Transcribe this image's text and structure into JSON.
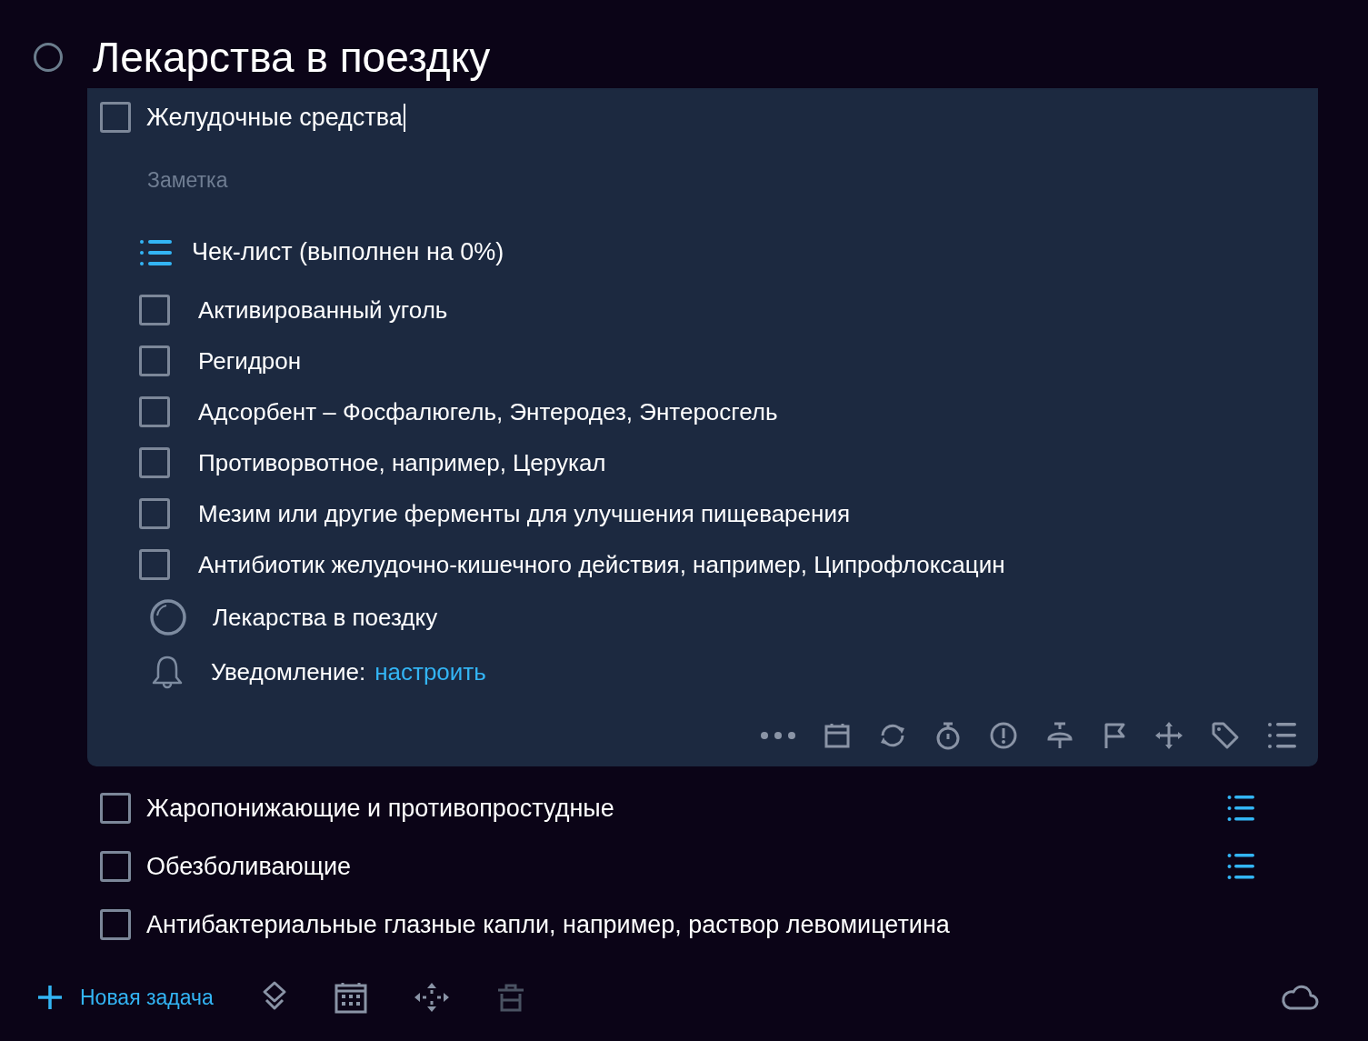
{
  "title": "Лекарства в поездку",
  "project_done": false,
  "expanded_task": {
    "title": "Желудочные средства",
    "checked": false,
    "note_placeholder": "Заметка",
    "checklist_title": "Чек-лист (выполнен на 0%)",
    "checklist": [
      {
        "text": "Активированный уголь",
        "checked": false
      },
      {
        "text": "Регидрон",
        "checked": false
      },
      {
        "text": "Адсорбент – Фосфалюгель, Энтеродез, Энтеросгель",
        "checked": false
      },
      {
        "text": "Противорвотное, например, Церукал",
        "checked": false
      },
      {
        "text": "Мезим или другие ферменты для улучшения пищеварения",
        "checked": false
      },
      {
        "text": "Антибиотик желудочно-кишечного действия, например, Ципрофлоксацин",
        "checked": false
      }
    ],
    "list_name": "Лекарства в поездку",
    "reminder_label": "Уведомление:",
    "reminder_link": "настроить"
  },
  "tasks": [
    {
      "title": "Жаропонижающие и противопростудные",
      "checked": false,
      "has_checklist": true
    },
    {
      "title": "Обезболивающие",
      "checked": false,
      "has_checklist": true
    },
    {
      "title": "Антибактериальные глазные капли, например, раствор левомицетина",
      "checked": false,
      "has_checklist": false
    }
  ],
  "footer": {
    "new_task": "Новая задача"
  }
}
